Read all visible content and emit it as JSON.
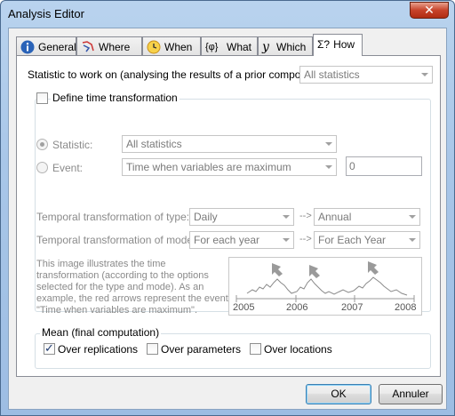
{
  "window": {
    "title": "Analysis Editor",
    "close_label": "✕"
  },
  "tabs": [
    {
      "label": "General",
      "icon": "info-icon"
    },
    {
      "label": "Where",
      "icon": "map-pin-icon"
    },
    {
      "label": "When",
      "icon": "clock-icon"
    },
    {
      "label": "What",
      "icon": "braces-icon"
    },
    {
      "label": "Which",
      "icon": "function-icon"
    },
    {
      "label": "How",
      "icon": "sigma-icon",
      "prefix": "Σ?",
      "active": true
    }
  ],
  "statistic_row": {
    "label": "Statistic to work on (analysing the results of a prior component):",
    "value": "All statistics"
  },
  "time_transformation": {
    "checkbox_label": "Define time transformation",
    "checked": false,
    "statistic_label": "Statistic:",
    "statistic_value": "All statistics",
    "event_label": "Event:",
    "event_value": "Time when variables are maximum",
    "event_number": "0",
    "type_label": "Temporal transformation of type:",
    "type_from": "Daily",
    "type_to": "Annual",
    "mode_label": "Temporal transformation of mode:",
    "mode_from": "For each year",
    "mode_to": "For Each Year",
    "arrow": "-->",
    "description": "This image illustrates the time transformation (according to the options selected for the type and mode). As an example, the red arrows represent the event \"Time when variables are maximum\".",
    "axis_years": [
      "2005",
      "2006",
      "2007",
      "2008"
    ]
  },
  "mean": {
    "title": "Mean (final computation)",
    "over_replications": "Over replications",
    "over_parameters": "Over parameters",
    "over_locations": "Over locations",
    "replications_checked": true
  },
  "buttons": {
    "ok": "OK",
    "cancel": "Annuler"
  }
}
